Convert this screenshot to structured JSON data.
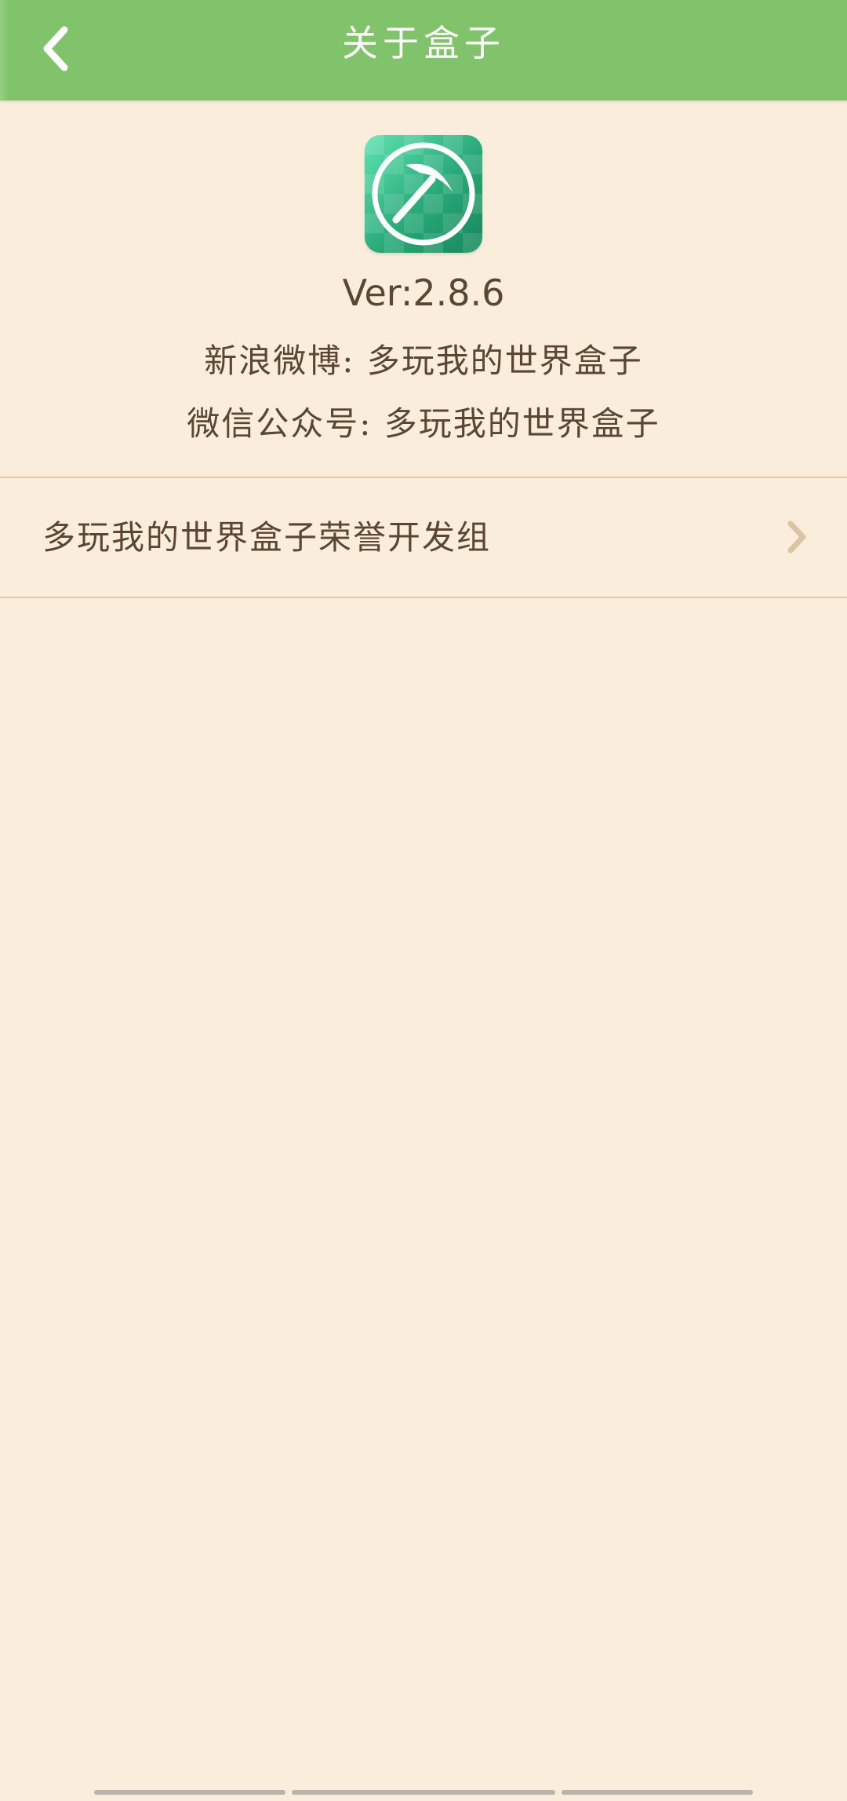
{
  "header": {
    "title": "关于盒子"
  },
  "hero": {
    "version": "Ver:2.8.6",
    "weibo": "新浪微博:  多玩我的世界盒子",
    "wechat": "微信公众号:  多玩我的世界盒子"
  },
  "list": [
    {
      "label": "多玩我的世界盒子荣誉开发组"
    }
  ],
  "icons": {
    "back": "chevron-left-icon",
    "app": "pickaxe-icon",
    "item_arrow": "chevron-right-icon"
  },
  "colors": {
    "app_bar": "#80c36a",
    "background": "#faeddb",
    "text": "#5a4632",
    "divider": "#e1c7a6",
    "icon_green": "#29a978"
  }
}
